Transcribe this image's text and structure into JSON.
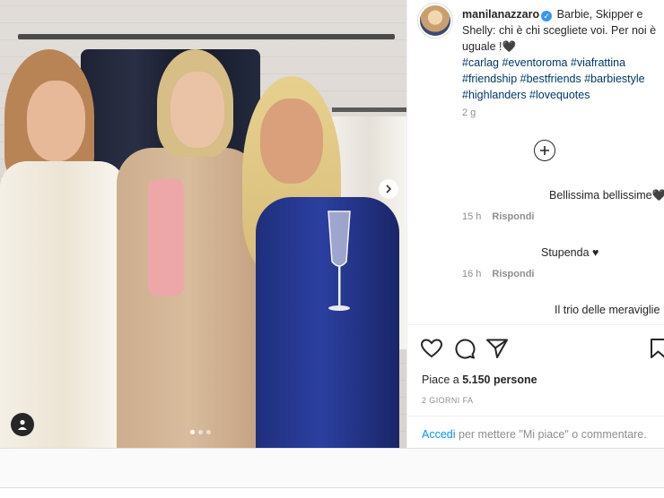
{
  "post": {
    "username": "manilanazzaro",
    "caption_text": "Barbie, Skipper e Shelly: chi è chi scegliete voi. Per noi è uguale !🖤",
    "hashtags": "#carlag #eventoroma #viafrattina #friendship #bestfriends #barbiestyle #highlanders #lovequotes",
    "caption_age": "2 g",
    "icons": {
      "verified": "verified-badge-icon",
      "load_more": "plus-circle-icon",
      "next": "chevron-right-icon",
      "tag": "user-tag-icon",
      "like": "heart-icon",
      "comment": "comment-icon",
      "share": "send-icon",
      "save": "bookmark-icon"
    }
  },
  "comments": [
    {
      "text": "Bellissima bellissime🖤",
      "age": "15 h",
      "reply": "Rispondi"
    },
    {
      "text": "Stupenda ♥",
      "age": "16 h",
      "reply": "Rispondi"
    },
    {
      "text": "Il trio delle meraviglie",
      "age": "",
      "reply": ""
    }
  ],
  "engagement": {
    "likes_prefix": "Piace a",
    "likes_count": "5.150 persone",
    "date": "2 GIORNI FA"
  },
  "login_prompt": {
    "link": "Accedi",
    "text": "per mettere \"Mi piace\" o commentare."
  },
  "carousel": {
    "slides": 3,
    "active": 0
  },
  "colors": {
    "accent": "#0095f6",
    "link": "#00376b",
    "muted": "#8e8e8e",
    "verified": "#3897f0"
  }
}
